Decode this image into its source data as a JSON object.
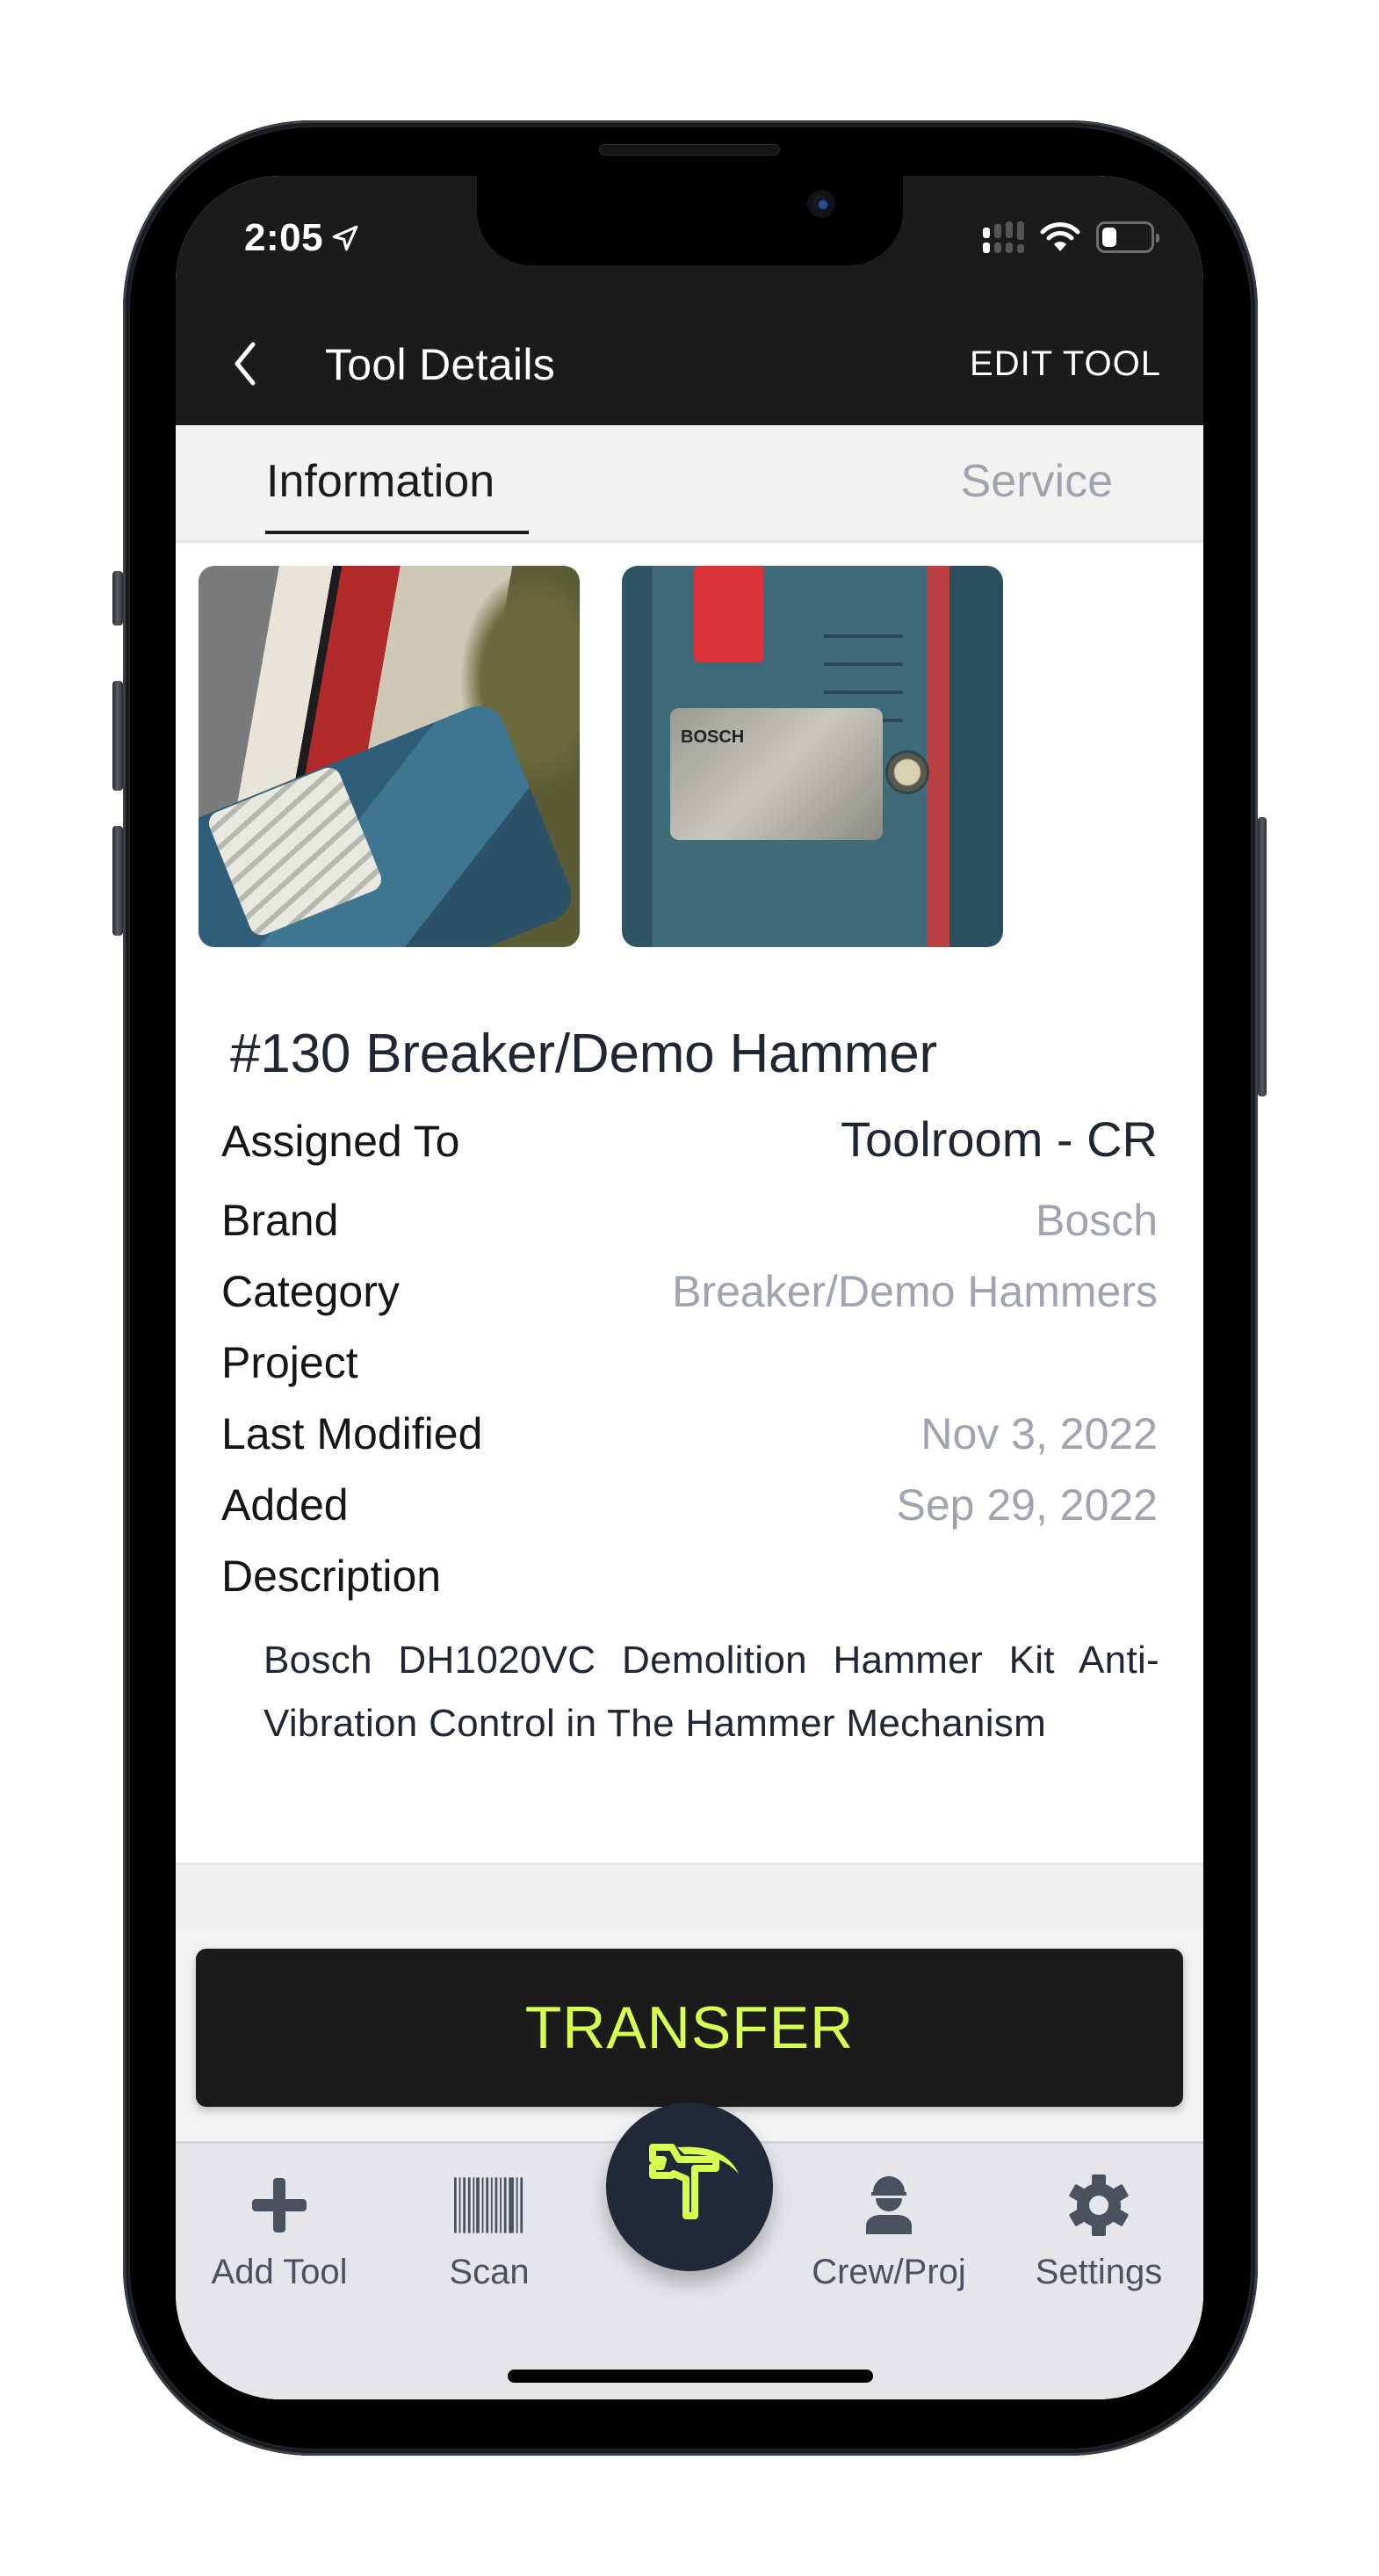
{
  "status_bar": {
    "time": "2:05",
    "location_icon": "location-arrow-icon",
    "signal_icon": "cellular-signal-icon",
    "wifi_icon": "wifi-icon",
    "battery_icon": "battery-icon",
    "battery_level": 0.3
  },
  "nav": {
    "back_icon": "chevron-left-icon",
    "title": "Tool Details",
    "edit_label": "EDIT TOOL"
  },
  "tabs": [
    {
      "label": "Information",
      "active": true
    },
    {
      "label": "Service",
      "active": false
    }
  ],
  "photos": [
    {
      "alt": "Bosch demolition hammer marked #130 in truck bed"
    },
    {
      "alt": "Bosch nameplate close-up",
      "plate_text": "BOSCH"
    }
  ],
  "tool": {
    "name": "#130 Breaker/Demo Hammer",
    "fields": [
      {
        "label": "Assigned To",
        "value": "Toolroom - CR"
      },
      {
        "label": "Brand",
        "value": "Bosch"
      },
      {
        "label": "Category",
        "value": "Breaker/Demo Hammers"
      },
      {
        "label": "Project",
        "value": ""
      },
      {
        "label": "Last Modified",
        "value": "Nov 3, 2022"
      },
      {
        "label": "Added",
        "value": "Sep 29, 2022"
      },
      {
        "label": "Description",
        "value": ""
      }
    ],
    "description": "Bosch DH1020VC Demolition Hammer Kit Anti-Vibration Control in The Hammer Mechanism"
  },
  "actions": {
    "transfer_label": "TRANSFER"
  },
  "tabbar": {
    "items": [
      {
        "label": "Add Tool",
        "icon": "plus-icon"
      },
      {
        "label": "Scan",
        "icon": "barcode-icon"
      },
      {
        "label": "",
        "icon": "toolbox-logo-icon"
      },
      {
        "label": "Crew/Proj",
        "icon": "worker-icon"
      },
      {
        "label": "Settings",
        "icon": "gear-icon"
      }
    ]
  },
  "colors": {
    "accent": "#d7ff52",
    "header_bg": "#1b1b1b",
    "fab_bg": "#212837",
    "muted_text": "#a0a4ae",
    "tabbar_text": "#4a5260"
  }
}
